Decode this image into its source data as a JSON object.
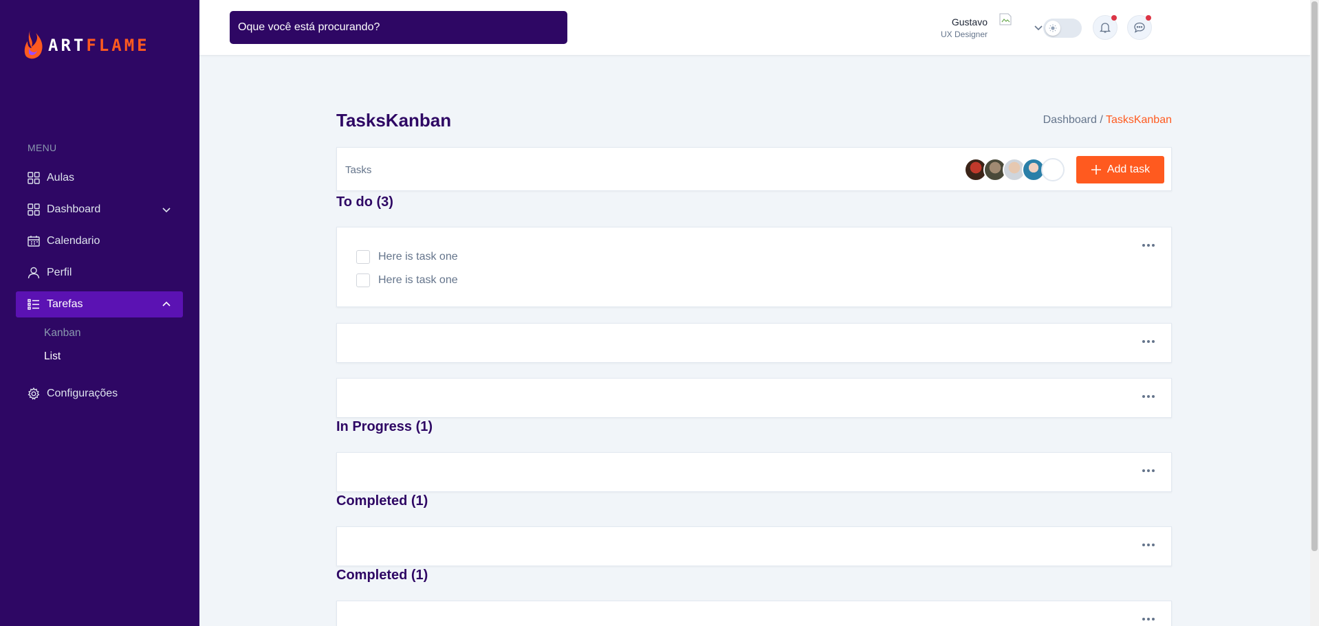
{
  "brand": {
    "logo_prefix": "ART",
    "logo_suffix": "FLAME",
    "accent": "#ff5a1f",
    "sidebar_bg": "#2e0764"
  },
  "sidebar": {
    "menu_title": "MENU",
    "items": [
      {
        "label": "Aulas",
        "icon": "grid-icon"
      },
      {
        "label": "Dashboard",
        "icon": "grid-icon"
      },
      {
        "label": "Calendario",
        "icon": "calendar-icon"
      },
      {
        "label": "Perfil",
        "icon": "user-icon"
      },
      {
        "label": "Tarefas",
        "icon": "list-icon"
      },
      {
        "label": "Configurações",
        "icon": "gear-icon"
      }
    ],
    "subitems": [
      {
        "label": "Kanban"
      },
      {
        "label": "List"
      }
    ]
  },
  "header": {
    "search_placeholder": "Oque você está procurando?",
    "user_name": "Gustavo",
    "user_role": "UX Designer"
  },
  "main": {
    "title": "TasksKanban",
    "breadcrumb_parent": "Dashboard /",
    "breadcrumb_current": "TasksKanban",
    "tasks_label": "Tasks",
    "add_task_label": "Add task",
    "sections": [
      {
        "title": "To do (3)"
      },
      {
        "title": "In Progress (1)"
      },
      {
        "title": "Completed (1)"
      },
      {
        "title": "Completed (1)"
      }
    ],
    "todo_tasks": [
      {
        "text": "Here is task one"
      },
      {
        "text": "Here is task one"
      }
    ]
  }
}
